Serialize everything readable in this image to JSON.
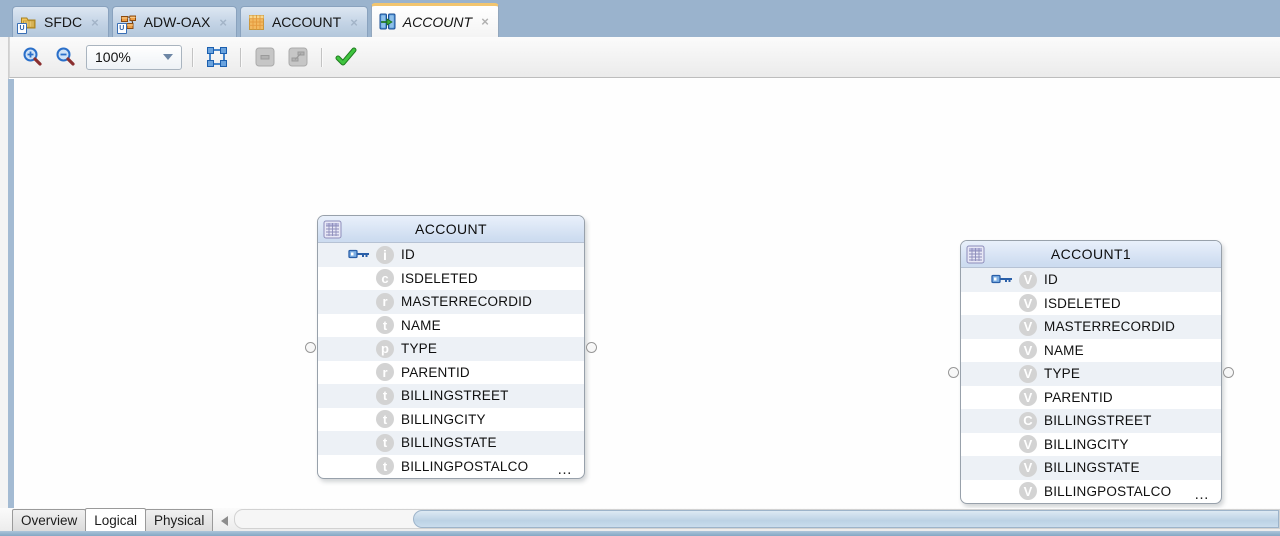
{
  "tab_bar": {
    "close_glyph": "×",
    "badge_glyph": "U",
    "tabs": [
      {
        "label": "SFDC",
        "icon": "folder-table-icon"
      },
      {
        "label": "ADW-OAX",
        "icon": "model-diagram-icon"
      },
      {
        "label": "ACCOUNT",
        "icon": "table-grid-icon"
      },
      {
        "label": "ACCOUNT",
        "icon": "mapping-icon",
        "active": true
      }
    ]
  },
  "toolbar": {
    "zoom_level": "100%"
  },
  "canvas": {
    "entities": [
      {
        "title": "ACCOUNT",
        "truncation_indicator": "…",
        "attributes": [
          {
            "name": "ID",
            "type_letter": "i",
            "key": true
          },
          {
            "name": "ISDELETED",
            "type_letter": "c"
          },
          {
            "name": "MASTERRECORDID",
            "type_letter": "r"
          },
          {
            "name": "NAME",
            "type_letter": "t"
          },
          {
            "name": "TYPE",
            "type_letter": "p"
          },
          {
            "name": "PARENTID",
            "type_letter": "r"
          },
          {
            "name": "BILLINGSTREET",
            "type_letter": "t"
          },
          {
            "name": "BILLINGCITY",
            "type_letter": "t"
          },
          {
            "name": "BILLINGSTATE",
            "type_letter": "t"
          },
          {
            "name": "BILLINGPOSTALCO",
            "type_letter": "t"
          }
        ]
      },
      {
        "title": "ACCOUNT1",
        "truncation_indicator": "…",
        "attributes": [
          {
            "name": "ID",
            "type_letter": "V",
            "key": true
          },
          {
            "name": "ISDELETED",
            "type_letter": "V"
          },
          {
            "name": "MASTERRECORDID",
            "type_letter": "V"
          },
          {
            "name": "NAME",
            "type_letter": "V"
          },
          {
            "name": "TYPE",
            "type_letter": "V"
          },
          {
            "name": "PARENTID",
            "type_letter": "V"
          },
          {
            "name": "BILLINGSTREET",
            "type_letter": "C"
          },
          {
            "name": "BILLINGCITY",
            "type_letter": "V"
          },
          {
            "name": "BILLINGSTATE",
            "type_letter": "V"
          },
          {
            "name": "BILLINGPOSTALCO",
            "type_letter": "V"
          }
        ]
      }
    ]
  },
  "bottom_bar": {
    "tabs": [
      {
        "label": "Overview"
      },
      {
        "label": "Logical",
        "active": true
      },
      {
        "label": "Physical"
      }
    ]
  },
  "colors": {
    "tab_bar_bg": "#9ab3cd",
    "active_tab_accent": "#f2c56f",
    "entity_header_bg": "#cddcf0",
    "row_alt_bg": "#edf1f6",
    "bottom_edge": "#84a7c4",
    "check_green": "#2fa832"
  }
}
